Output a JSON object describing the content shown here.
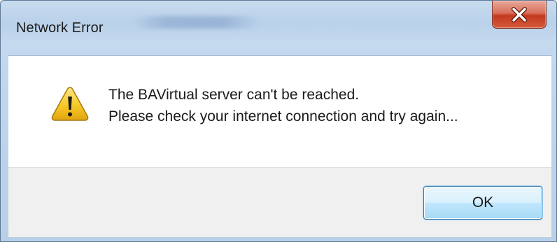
{
  "window": {
    "title": "Network Error",
    "close_icon": "close-icon"
  },
  "message": {
    "icon": "warning-icon",
    "line1": "The BAVirtual server can't be reached.",
    "line2": "Please check your internet connection and try again..."
  },
  "buttons": {
    "ok_label": "OK"
  },
  "colors": {
    "frame": "#b9d1ea",
    "close_button": "#c4391f",
    "warning_yellow": "#f2c21b",
    "ok_button": "#bee6fd"
  }
}
